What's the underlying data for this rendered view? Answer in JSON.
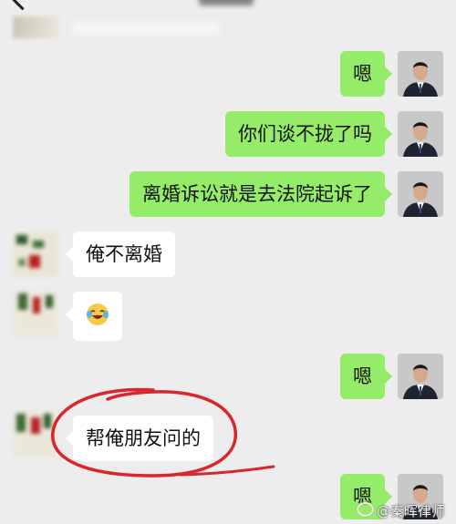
{
  "messages": [
    {
      "sender": "me",
      "text": "嗯"
    },
    {
      "sender": "me",
      "text": "你们谈不拢了吗"
    },
    {
      "sender": "me",
      "text": "离婚诉讼就是去法院起诉了"
    },
    {
      "sender": "them",
      "text": "俺不离婚"
    },
    {
      "sender": "them",
      "emoji": "laughing-crying-emoji"
    },
    {
      "sender": "me",
      "text": "嗯"
    },
    {
      "sender": "them",
      "text": "帮俺朋友问的"
    },
    {
      "sender": "me",
      "text": "嗯"
    }
  ],
  "highlight_color": "#d9262b",
  "bubble_colors": {
    "me": "#95ec69",
    "them": "#ffffff"
  },
  "watermark": {
    "icon": "weibo-icon",
    "text": "@秦晖律师"
  }
}
